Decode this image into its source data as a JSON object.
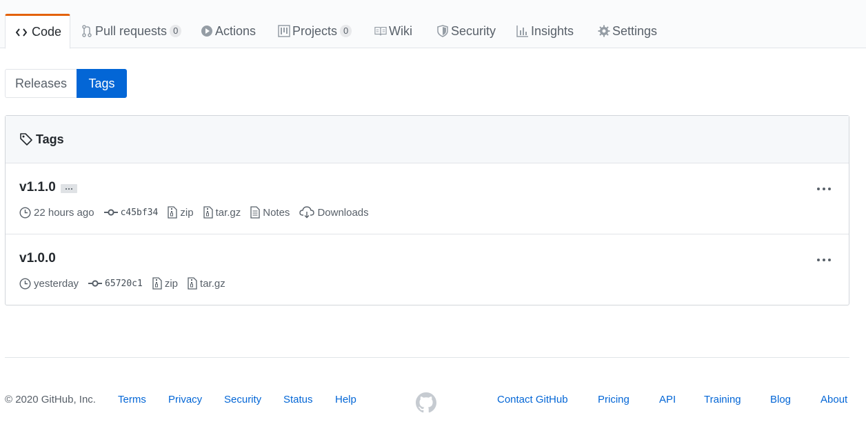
{
  "nav": {
    "tabs": [
      {
        "label": "Code",
        "icon": "code-icon",
        "selected": true
      },
      {
        "label": "Pull requests",
        "icon": "git-pull-request-icon",
        "count": "0"
      },
      {
        "label": "Actions",
        "icon": "play-icon"
      },
      {
        "label": "Projects",
        "icon": "project-icon",
        "count": "0"
      },
      {
        "label": "Wiki",
        "icon": "book-icon"
      },
      {
        "label": "Security",
        "icon": "shield-icon"
      },
      {
        "label": "Insights",
        "icon": "graph-icon"
      },
      {
        "label": "Settings",
        "icon": "gear-icon"
      }
    ],
    "accent_color": "#e36209"
  },
  "subnav": {
    "releases_label": "Releases",
    "tags_label": "Tags",
    "active": "Tags",
    "active_color": "#0366d6"
  },
  "box": {
    "header": "Tags",
    "tags": [
      {
        "name": "v1.1.0",
        "has_message": true,
        "ellipsis": "...",
        "time": "22 hours ago",
        "commit": "c45bf34",
        "zip": "zip",
        "targz": "tar.gz",
        "notes": "Notes",
        "downloads": "Downloads"
      },
      {
        "name": "v1.0.0",
        "time": "yesterday",
        "commit": "65720c1",
        "zip": "zip",
        "targz": "tar.gz"
      }
    ]
  },
  "footer": {
    "copyright": "© 2020 GitHub, Inc.",
    "left_links": [
      "Terms",
      "Privacy",
      "Security",
      "Status",
      "Help"
    ],
    "right_links": [
      "Contact GitHub",
      "Pricing",
      "API",
      "Training",
      "Blog",
      "About"
    ],
    "link_color": "#0366d6"
  }
}
